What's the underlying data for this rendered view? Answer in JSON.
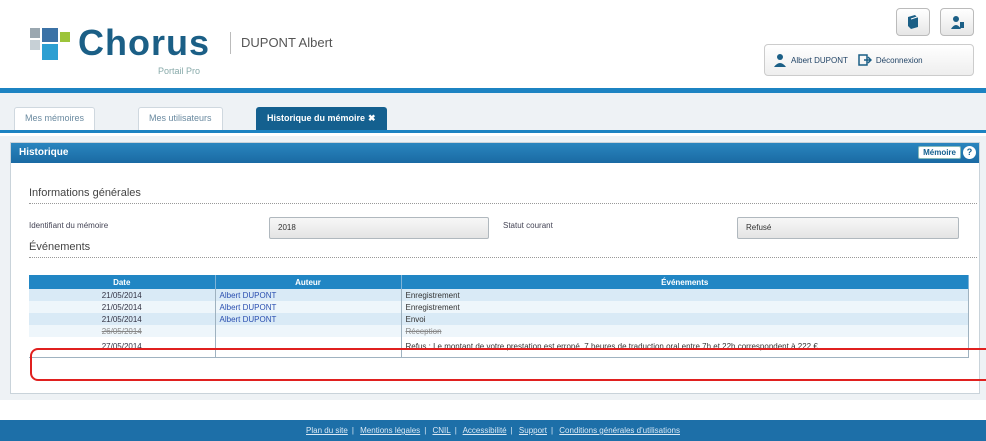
{
  "header": {
    "logo_text": "Chorus",
    "logo_sub": "Portail Pro",
    "user_name": "DUPONT Albert",
    "user_link": "Albert DUPONT",
    "logout_label": "Déconnexion"
  },
  "tabs": [
    {
      "label": "Mes mémoires"
    },
    {
      "label": "Mes utilisateurs"
    },
    {
      "label": "Historique du mémoire",
      "close": "✖"
    }
  ],
  "panel": {
    "title": "Historique",
    "memoire_button": "Mémoire",
    "help": "?",
    "general_section": "Informations générales",
    "id_label": "Identifiant du mémoire",
    "id_value": "2018",
    "status_label": "Statut courant",
    "status_value": "Refusé",
    "events_section": "Événements"
  },
  "table": {
    "headers": [
      "Date",
      "Auteur",
      "Événements"
    ],
    "rows": [
      {
        "date": "21/05/2014",
        "author": "Albert DUPONT",
        "event": "Enregistrement"
      },
      {
        "date": "21/05/2014",
        "author": "Albert DUPONT",
        "event": "Enregistrement"
      },
      {
        "date": "21/05/2014",
        "author": "Albert DUPONT",
        "event": "Envoi"
      },
      {
        "date": "26/05/2014",
        "author": "",
        "event": "Réception"
      },
      {
        "date": "27/05/2014",
        "author": "",
        "event": "Refus : Le montant de votre prestation est erroné. 7 heures de traduction oral entre 7h et 22h correspondent à 222 €"
      }
    ]
  },
  "footer": {
    "links": [
      "Plan du site",
      "Mentions légales",
      "CNIL",
      "Accessibilité",
      "Support",
      "Conditions générales d'utilisations"
    ],
    "separator": "|"
  },
  "colors": {
    "brand_blue": "#1c83c2",
    "header_blue": "#14608f",
    "highlight_red": "#e0201f"
  }
}
